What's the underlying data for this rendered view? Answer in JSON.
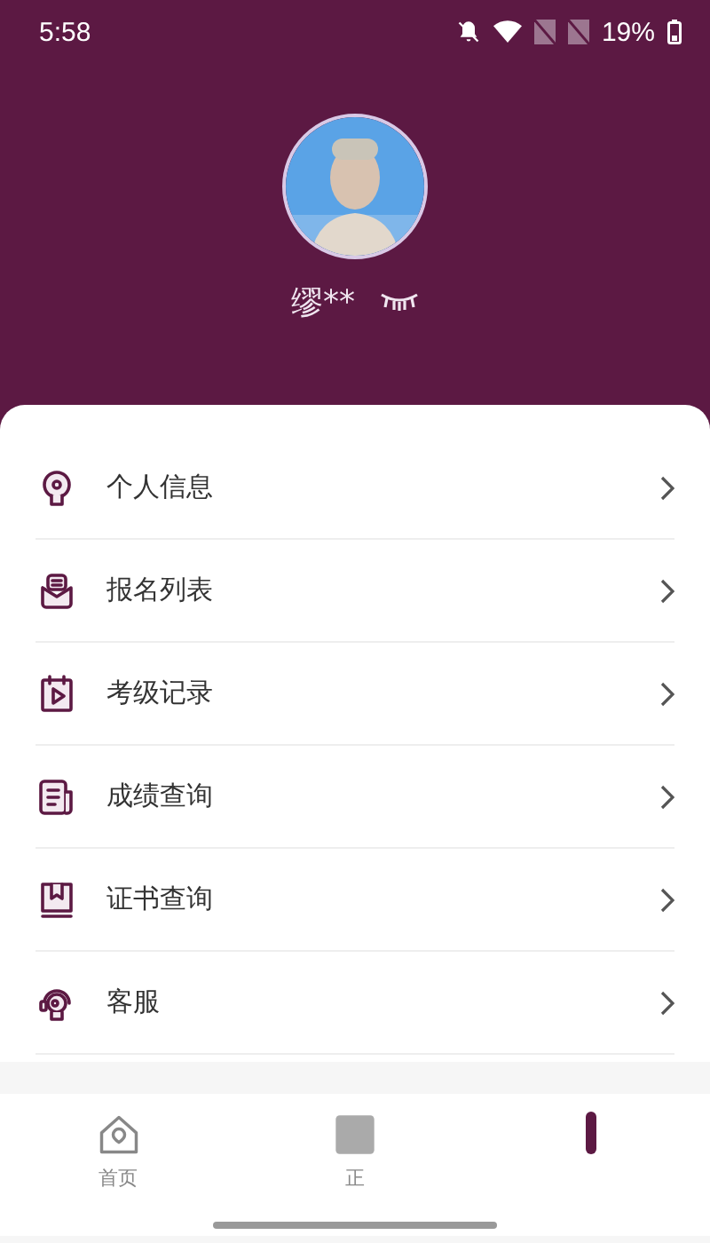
{
  "status_bar": {
    "time": "5:58",
    "battery": "19%"
  },
  "profile": {
    "name": "缪**"
  },
  "menu": [
    {
      "label": "个人信息"
    },
    {
      "label": "报名列表"
    },
    {
      "label": "考级记录"
    },
    {
      "label": "成绩查询"
    },
    {
      "label": "证书查询"
    },
    {
      "label": "客服"
    }
  ],
  "tabs": [
    {
      "label": "首页",
      "selected": false
    },
    {
      "label": "正",
      "selected": false
    },
    {
      "selected": true
    }
  ]
}
